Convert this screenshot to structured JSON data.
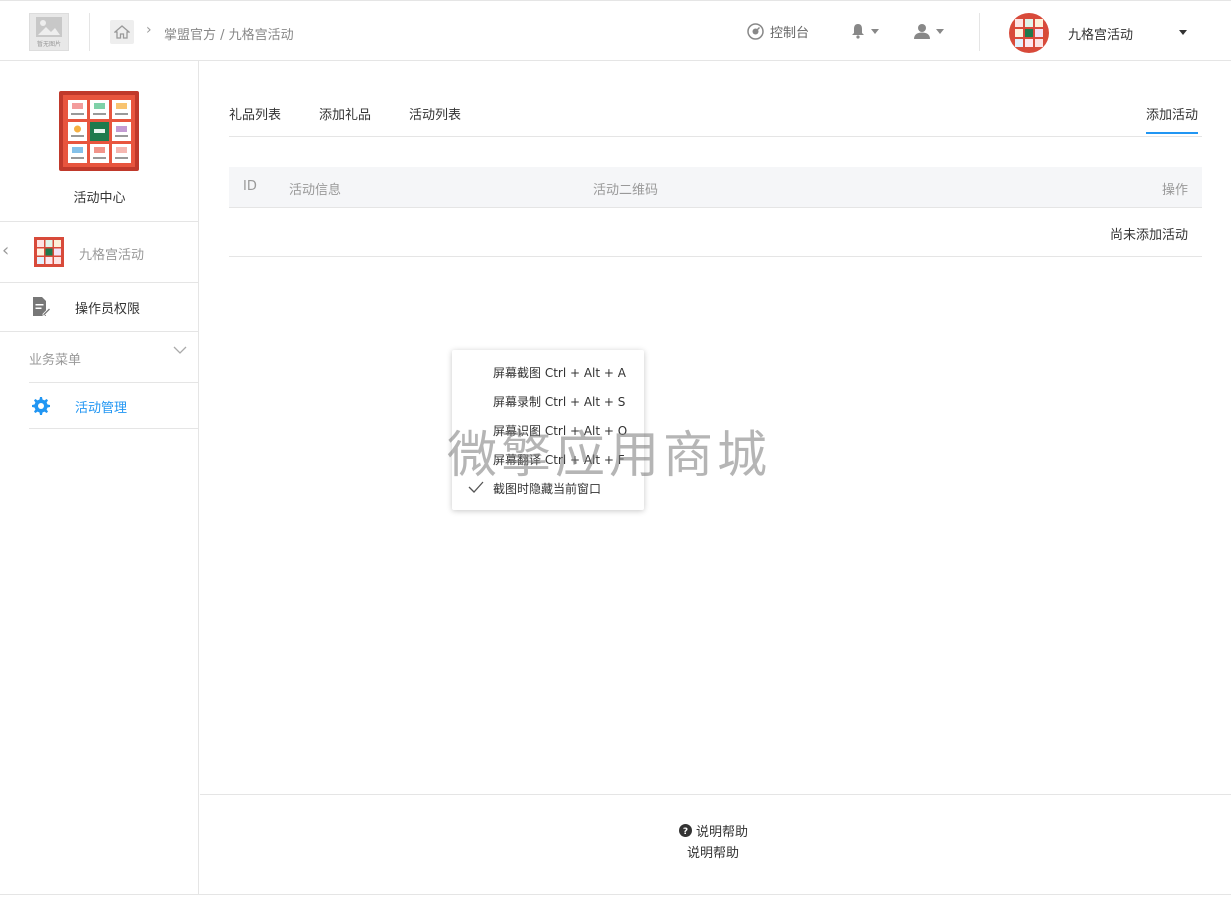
{
  "topbar": {
    "logo_caption": "暂无图片",
    "breadcrumb": "掌盟官方 / 九格宫活动",
    "console_label": "控制台",
    "account_name": "九格宫活动"
  },
  "sidebar": {
    "brand_name": "活动中心",
    "app_name": "九格宫活动",
    "permissions_label": "操作员权限",
    "business_menu_label": "业务菜单",
    "activity_management_label": "活动管理"
  },
  "tabs": [
    {
      "label": "礼品列表"
    },
    {
      "label": "添加礼品"
    },
    {
      "label": "活动列表"
    },
    {
      "label": "添加活动"
    }
  ],
  "table": {
    "headers": [
      "ID",
      "活动信息",
      "活动二维码",
      "操作"
    ],
    "empty_text": "尚未添加活动"
  },
  "context_menu": {
    "items": [
      {
        "label": "屏幕截图 Ctrl + Alt + A"
      },
      {
        "label": "屏幕录制 Ctrl + Alt + S"
      },
      {
        "label": "屏幕识图 Ctrl + Alt + O"
      },
      {
        "label": "屏幕翻译 Ctrl + Alt + F"
      },
      {
        "label": "截图时隐藏当前窗口"
      }
    ]
  },
  "watermark": "微擎应用商城",
  "footer": {
    "help_link": "说明帮助",
    "help_text": "说明帮助"
  },
  "colors": {
    "accent": "#2196f3",
    "border": "#e5e5e5",
    "header_bg": "#f5f6f8"
  }
}
